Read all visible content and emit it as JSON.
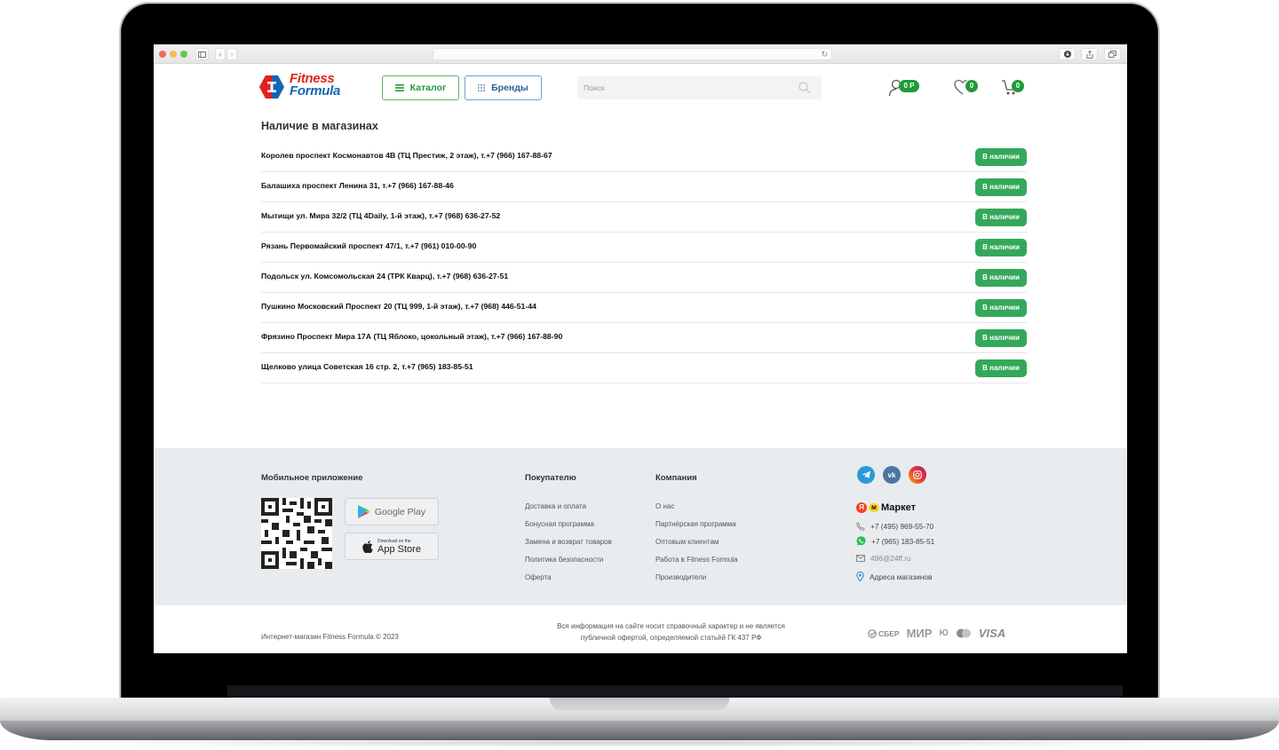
{
  "browser": {
    "window_controls": [
      "close",
      "minimize",
      "zoom"
    ],
    "toolbar_left_icons": [
      "sidebar-icon",
      "back-icon",
      "forward-icon"
    ],
    "toolbar_right_icons": [
      "download-icon",
      "share-icon",
      "tabs-icon"
    ],
    "reload_icon": "reload-icon",
    "address": ""
  },
  "header": {
    "logo": {
      "line1": "Fitness",
      "line2": "Formula",
      "reg": "®"
    },
    "catalog_label": "Каталог",
    "brands_label": "Бренды",
    "search_placeholder": "Поиск",
    "account_badge": "0 Р",
    "favorites_badge": "0",
    "cart_badge": "0",
    "brand_colors": {
      "green": "#1f9a3a",
      "blue": "#1266b4",
      "red": "#e2211c"
    }
  },
  "stores": {
    "title": "Наличие в магазинах",
    "rows": [
      {
        "name": "Королев проспект Космонавтов 4В (ТЦ Престиж, 2 этаж), т.+7 (966) 167-88-67",
        "status": "В наличии"
      },
      {
        "name": "Балашиха проспект Ленина 31, т.+7 (966) 167-88-46",
        "status": "В наличии"
      },
      {
        "name": "Мытищи ул. Мира 32/2 (ТЦ 4Daily, 1-й этаж), т.+7 (968) 636-27-52",
        "status": "В наличии"
      },
      {
        "name": "Рязань Первомайский проспект 47/1, т.+7 (961) 010-00-90",
        "status": "В наличии"
      },
      {
        "name": "Подольск ул. Комсомольская 24 (ТРК Кварц), т.+7 (968) 636-27-51",
        "status": "В наличии"
      },
      {
        "name": "Пушкино Московский Проспект 20 (ТЦ 999, 1-й этаж), т.+7 (968) 446-51-44",
        "status": "В наличии"
      },
      {
        "name": "Фрязино Проспект Мира 17А (ТЦ Яблоко, цокольный этаж), т.+7 (966) 167-88-90",
        "status": "В наличии"
      },
      {
        "name": "Щелково улица Советская 16 стр. 2, т.+7 (965) 183-85-51",
        "status": "В наличии"
      }
    ],
    "status_color": "#34a85a"
  },
  "footer": {
    "app_title": "Мобильное приложение",
    "google_play": "Google Play",
    "app_store_small": "Download on the",
    "app_store_big": "App Store",
    "buyer_title": "Покупателю",
    "buyer_links": [
      "Доставка и оплата",
      "Бонусная программа",
      "Замена и возврат товаров",
      "Политика безопасности",
      "Оферта"
    ],
    "company_title": "Компания",
    "company_links": [
      "О нас",
      "Партнёрская программа",
      "Оптовым клиентам",
      "Работа в Fitness Formula",
      "Производители"
    ],
    "social": [
      "telegram",
      "vk",
      "instagram"
    ],
    "market_label": "Маркет",
    "phone": "+7 (495) 969-55-70",
    "whatsapp": "+7 (965) 183-85-51",
    "email": "496@24ff.ru",
    "stores_link": "Адреса магазинов",
    "copyright": "Интернет-магазин Fitness Formula © 2023",
    "disclaimer_line1": "Вся информация на сайте носит справочный характер и не является",
    "disclaimer_line2": "публичной офертой, определяемой статьёй ГК 437 РФ",
    "payments": [
      "СБЕР",
      "МИР",
      "Ю",
      "Mastercard",
      "VISA"
    ]
  }
}
